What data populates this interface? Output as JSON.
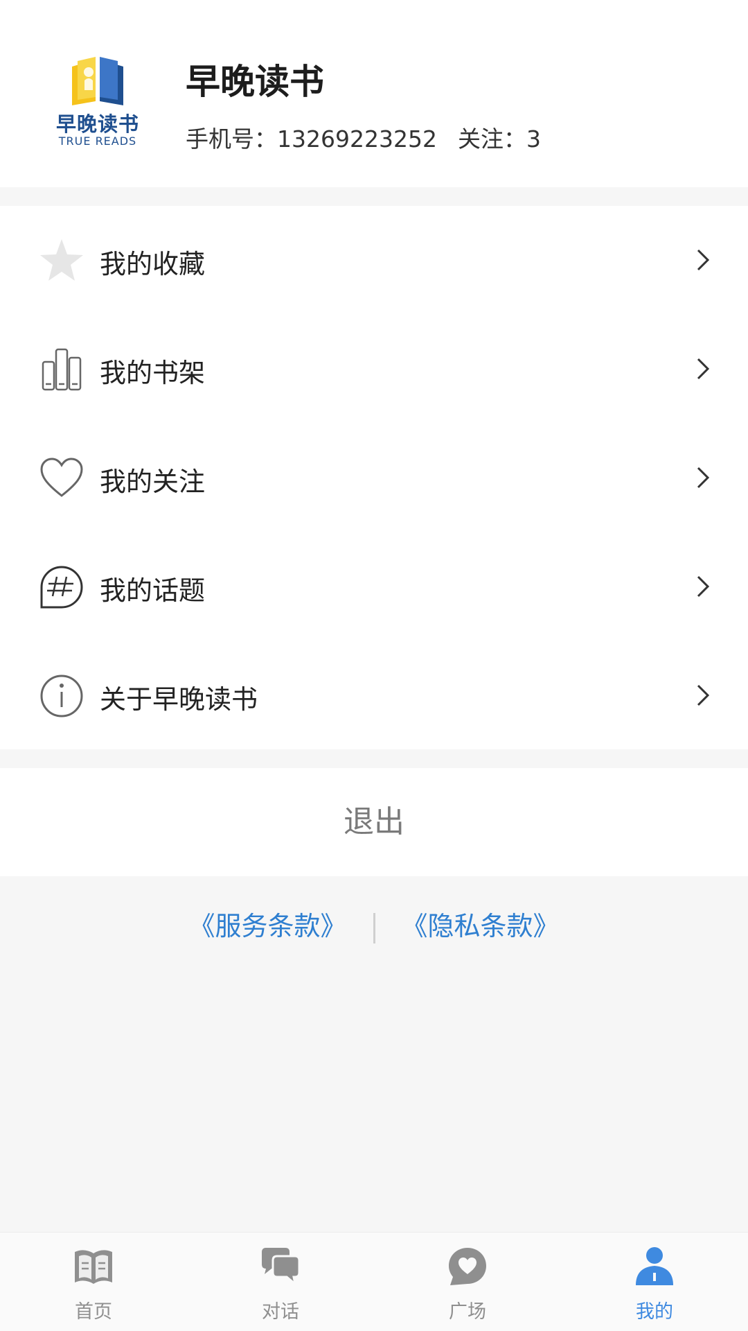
{
  "profile": {
    "logo_cn": "早晚读书",
    "logo_en": "TRUE READS",
    "name": "早晚读书",
    "phone": "手机号：13269223252",
    "following": "关注：3"
  },
  "menu": {
    "items": [
      {
        "label": "我的收藏",
        "icon": "star-icon"
      },
      {
        "label": "我的书架",
        "icon": "bookshelf-icon"
      },
      {
        "label": "我的关注",
        "icon": "heart-icon"
      },
      {
        "label": "我的话题",
        "icon": "hashtag-bubble-icon"
      },
      {
        "label": "关于早晚读书",
        "icon": "info-icon"
      }
    ]
  },
  "logout_label": "退出",
  "legal": {
    "terms": "《服务条款》",
    "privacy": "《隐私条款》"
  },
  "tabbar": {
    "tabs": [
      {
        "label": "首页",
        "icon": "book-icon"
      },
      {
        "label": "对话",
        "icon": "chat-icon"
      },
      {
        "label": "广场",
        "icon": "heart-bubble-icon"
      },
      {
        "label": "我的",
        "icon": "user-icon"
      }
    ],
    "active_index": 3
  },
  "colors": {
    "accent": "#3f8ae0",
    "link": "#2f7fd0",
    "icon_gray": "#8f8f8f",
    "logo_blue": "#1f4f8f",
    "logo_yellow": "#f5c21b"
  }
}
